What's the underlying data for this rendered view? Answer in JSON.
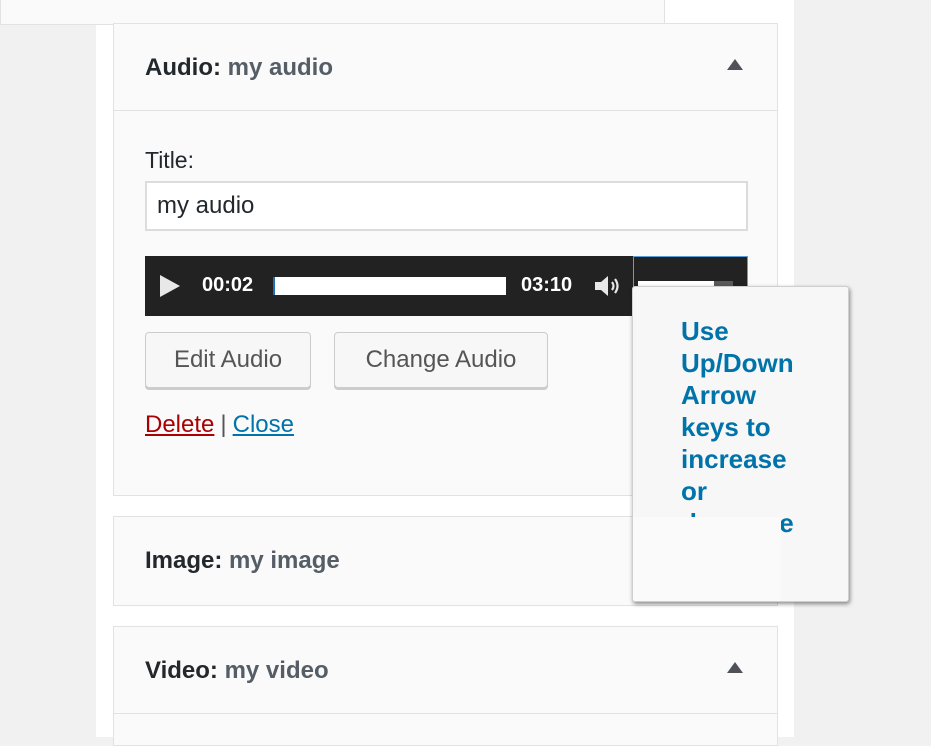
{
  "widgets": {
    "audio": {
      "type": "Audio:",
      "name": " my audio",
      "expanded": true
    },
    "image": {
      "type": "Image:",
      "name": " my image",
      "expanded": false
    },
    "video": {
      "type": "Video:",
      "name": " my video",
      "expanded": true
    }
  },
  "audio_form": {
    "title_label": "Title:",
    "title_value": "my audio",
    "player": {
      "current_time": "00:02",
      "duration": "03:10",
      "progress": 0.01,
      "volume": 0.8,
      "play_icon": "play-icon",
      "volume_icon": "speaker-icon"
    },
    "edit_button": "Edit Audio",
    "change_button": "Change Audio",
    "delete_link": "Delete",
    "separator": "|",
    "close_link": "Close"
  },
  "tooltip": {
    "text": "Use Up/Down Arrow keys to increase or decrease volume."
  },
  "colors": {
    "link_blue": "#0073aa",
    "delete_red": "#aa0000",
    "player_bg": "#222222",
    "focus_blue": "#5b9dd9"
  }
}
